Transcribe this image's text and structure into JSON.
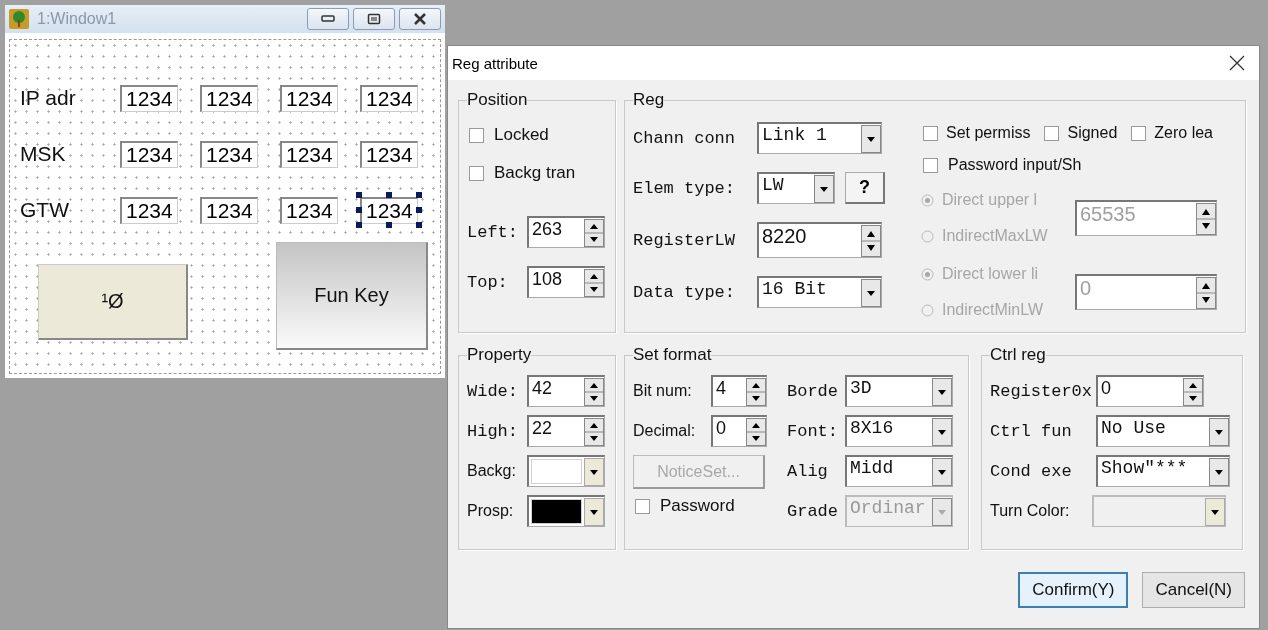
{
  "designer": {
    "title": "1:Window1",
    "rows": [
      {
        "label": "IP adr",
        "fields": [
          {
            "value": "1234",
            "selected": false
          },
          {
            "value": "1234",
            "selected": false
          },
          {
            "value": "1234",
            "selected": false
          },
          {
            "value": "1234",
            "selected": false
          }
        ]
      },
      {
        "label": "MSK",
        "fields": [
          {
            "value": "1234",
            "selected": false
          },
          {
            "value": "1234",
            "selected": false
          },
          {
            "value": "1234",
            "selected": false
          },
          {
            "value": "1234",
            "selected": false
          }
        ]
      },
      {
        "label": "GTW",
        "fields": [
          {
            "value": "1234",
            "selected": false
          },
          {
            "value": "1234",
            "selected": false
          },
          {
            "value": "1234",
            "selected": false
          },
          {
            "value": "1234",
            "selected": true
          }
        ]
      }
    ],
    "buttons": [
      {
        "label": "¹Ø",
        "kind": "flat"
      },
      {
        "label": "Fun Key",
        "kind": "gradient"
      }
    ]
  },
  "dialog": {
    "title": "Reg attribute",
    "position": {
      "title": "Position",
      "checkboxes": [
        {
          "label": "Locked",
          "checked": false
        },
        {
          "label": "Backg tran",
          "checked": false
        }
      ],
      "spinners": [
        {
          "label": "Left:",
          "value": "263"
        },
        {
          "label": "Top:",
          "value": "108"
        }
      ]
    },
    "reg": {
      "title": "Reg",
      "chann_conn": {
        "label": "Chann conn",
        "value": "Link 1"
      },
      "elem_type": {
        "label": "Elem type:",
        "value": "LW",
        "help": "?"
      },
      "register": {
        "label": "RegisterLW",
        "value": "8220"
      },
      "data_type": {
        "label": "Data type:",
        "value": "16 Bit"
      },
      "options": [
        {
          "label": "Set permiss",
          "checked": false
        },
        {
          "label": "Signed",
          "checked": false
        },
        {
          "label": "Zero lea",
          "checked": false
        }
      ],
      "password_input": {
        "label": "Password input/Sh",
        "checked": false
      },
      "limits": [
        {
          "disabled": true,
          "value": "65535",
          "radios": [
            {
              "label": "Direct upper l",
              "selected": true
            },
            {
              "label": "IndirectMaxLW",
              "selected": false
            }
          ]
        },
        {
          "disabled": true,
          "value": "0",
          "radios": [
            {
              "label": "Direct lower li",
              "selected": true
            },
            {
              "label": "IndirectMinLW",
              "selected": false
            }
          ]
        }
      ]
    },
    "property": {
      "title": "Property",
      "spinners": [
        {
          "label": "Wide:",
          "value": "42"
        },
        {
          "label": "High:",
          "value": "22"
        }
      ],
      "colors": [
        {
          "label": "Backg:",
          "color": "#ffffff"
        },
        {
          "label": "Prosp:",
          "color": "#000000"
        }
      ]
    },
    "set_format": {
      "title": "Set format",
      "spinners": [
        {
          "label": "Bit num:",
          "value": "4"
        },
        {
          "label": "Decimal:",
          "value": "0"
        }
      ],
      "notice_button": {
        "label": "NoticeSet...",
        "disabled": true
      },
      "password": {
        "label": "Password",
        "checked": false
      },
      "combos": [
        {
          "label": "Borde",
          "value": "3D",
          "disabled": false
        },
        {
          "label": "Font:",
          "value": "8X16",
          "disabled": false
        },
        {
          "label": "Alig",
          "value": "Midd",
          "disabled": false
        },
        {
          "label": "Grade",
          "value": "Ordinar",
          "disabled": true
        }
      ]
    },
    "ctrl_reg": {
      "title": "Ctrl reg",
      "register": {
        "label": "Register0x",
        "value": "0"
      },
      "combos": [
        {
          "label": "Ctrl fun",
          "value": "No Use"
        },
        {
          "label": "Cond exe",
          "value": "Show″***"
        }
      ],
      "turn_color": {
        "label": "Turn Color:",
        "disabled": true
      }
    },
    "buttons": [
      {
        "label": "Confirm(Y)",
        "default": true
      },
      {
        "label": "Cancel(N)",
        "default": false
      }
    ]
  }
}
